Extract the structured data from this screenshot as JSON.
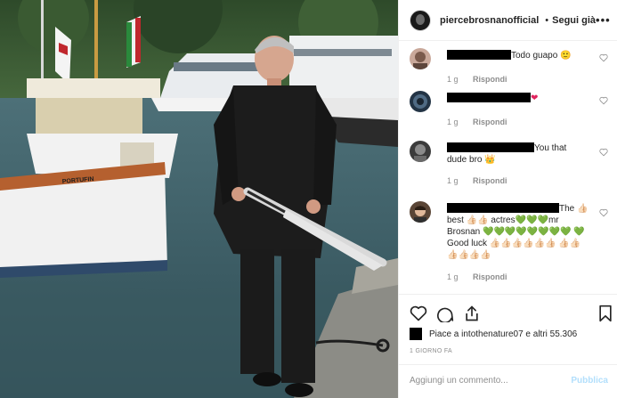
{
  "post": {
    "username": "piercebrosnanofficial",
    "separator": "•",
    "follow_label": "Segui già",
    "more_label": "•••"
  },
  "comments": [
    {
      "text_after": "Todo guapo",
      "emoji": "🙂",
      "time": "1 g",
      "reply_label": "Rispondi"
    },
    {
      "text_after": "❤",
      "time": "1 g",
      "reply_label": "Rispondi"
    },
    {
      "text_after": "You that dude bro",
      "emoji": "👑",
      "time": "1 g",
      "reply_label": "Rispondi"
    },
    {
      "text_after": "The 👍🏻 best 👍🏻👍🏻 actres💚💚💚mr Brosnan 💚💚💚💚💚💚💚💚 💚Good luck 👍🏻👍🏻👍🏻👍🏻👍🏻👍🏻 👍🏻👍🏻👍🏻👍🏻👍🏻👍🏻",
      "time": "1 g",
      "reply_label": "Rispondi"
    }
  ],
  "likes": {
    "text": "Piace a intothenature07 e altri 55.306"
  },
  "timestamp": "1 GIORNO FA",
  "add_comment": {
    "placeholder": "Aggiungi un commento...",
    "post_label": "Pubblica"
  },
  "photo": {
    "boat_name": "PORTUFIN"
  },
  "colors": {
    "link_blue": "#3897f0",
    "post_disabled": "#b2dffc",
    "muted": "#8e8e8e",
    "text": "#262626",
    "border": "#efefef"
  },
  "icons": [
    "verified-icon",
    "heart-icon",
    "comment-icon",
    "share-icon",
    "bookmark-icon",
    "more-icon"
  ]
}
